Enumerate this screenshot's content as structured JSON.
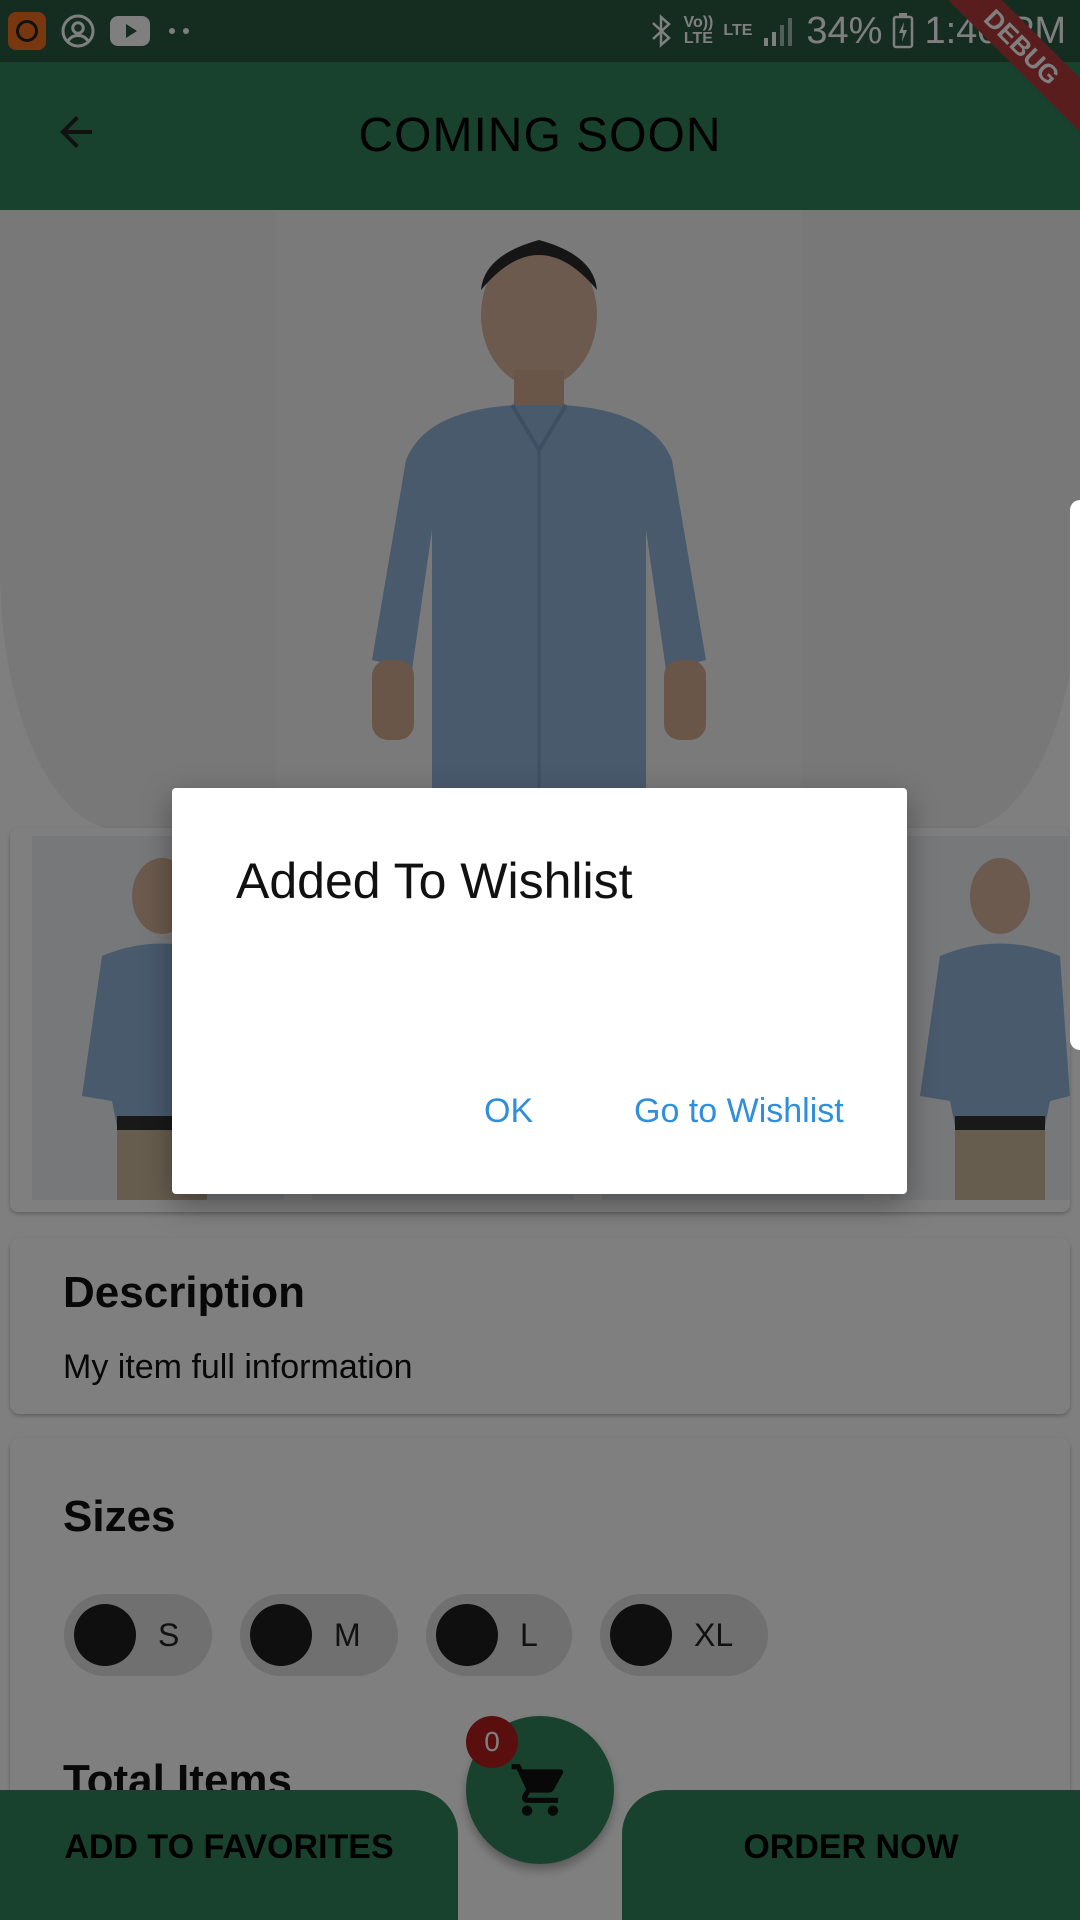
{
  "status_bar": {
    "battery": "34%",
    "time": "1:40 PM",
    "volte_top": "Vo))",
    "volte_bottom": "LTE",
    "lte": "LTE",
    "debug_label": "DEBUG",
    "icons": [
      "mi-app-icon",
      "account-circle-icon",
      "youtube-icon",
      "more-dots-icon",
      "bluetooth-icon",
      "signal-icon",
      "battery-charging-icon"
    ]
  },
  "app_bar": {
    "title": "COMING SOON",
    "back_icon": "arrow-back-icon"
  },
  "description": {
    "title": "Description",
    "text": "My item full information"
  },
  "sizes": {
    "title": "Sizes",
    "options": [
      "S",
      "M",
      "L",
      "XL"
    ]
  },
  "total_items": {
    "title": "Total Items"
  },
  "bottom_bar": {
    "add_to_favorites": "ADD TO FAVORITES",
    "order_now": "ORDER NOW",
    "cart_count": "0",
    "cart_icon": "shopping-cart-icon"
  },
  "dialog": {
    "title": "Added To Wishlist",
    "ok_label": "OK",
    "wishlist_label": "Go to Wishlist"
  },
  "colors": {
    "primary_green": "#33845d",
    "status_bar": "#2a5a41",
    "dialog_button": "#2f8fdc",
    "badge_red": "#b71c1c"
  }
}
